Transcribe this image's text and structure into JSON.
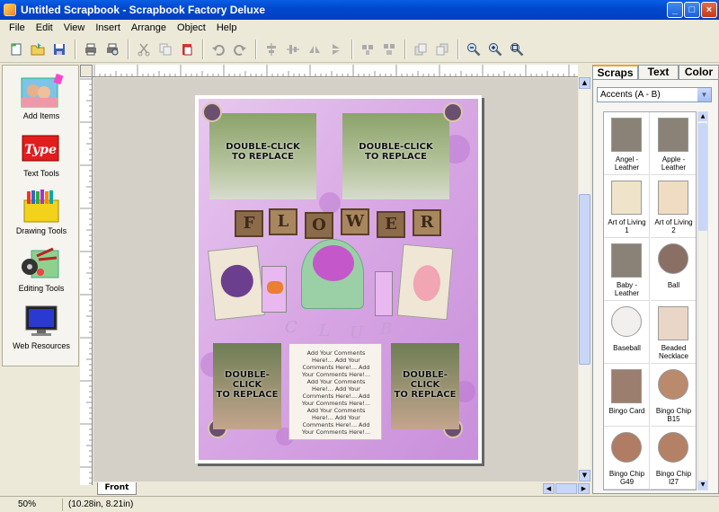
{
  "window": {
    "title": "Untitled Scrapbook - Scrapbook Factory Deluxe"
  },
  "menu": [
    "File",
    "Edit",
    "View",
    "Insert",
    "Arrange",
    "Object",
    "Help"
  ],
  "left_panel": {
    "items": [
      {
        "label": "Add Items"
      },
      {
        "label": "Text Tools"
      },
      {
        "label": "Drawing Tools"
      },
      {
        "label": "Editing Tools"
      },
      {
        "label": "Web Resources"
      }
    ]
  },
  "canvas": {
    "placeholder_text": "DOUBLE-CLICK\nTO REPLACE",
    "comment_text": "Add Your Comments\nHere!... Add Your\nComments Here!... Add\nYour Comments Here!...\nAdd Your Comments\nHere!... Add Your\nComments Here!... Add\nYour Comments Here!...\nAdd Your Comments\nHere!... Add Your\nComments Here!... Add\nYour Comments Here!...",
    "tiles_top": [
      "F",
      "L",
      "O",
      "W",
      "E",
      "R"
    ],
    "tiles_bottom": [
      "C",
      "L",
      "U",
      "B"
    ]
  },
  "bottom_tab": "Front",
  "status": {
    "zoom": "50%",
    "coords": "(10.28in, 8.21in)"
  },
  "right_panel": {
    "tabs": [
      "Scraps",
      "Text",
      "Color"
    ],
    "active_tab": "Scraps",
    "category": "Accents (A - B)",
    "items": [
      {
        "label": "Angel -\nLeather",
        "color": "#8a8276"
      },
      {
        "label": "Apple -\nLeather",
        "color": "#8a8276"
      },
      {
        "label": "Art of Living\n1",
        "color": "#efe3c9"
      },
      {
        "label": "Art of Living\n2",
        "color": "#efdcc3"
      },
      {
        "label": "Baby -\nLeather",
        "color": "#8a8276"
      },
      {
        "label": "Ball",
        "color": "#8a6f64"
      },
      {
        "label": "Baseball",
        "color": "#f2f0ee"
      },
      {
        "label": "Beaded\nNecklace",
        "color": "#e9d6c7"
      },
      {
        "label": "Bingo Card",
        "color": "#9c7e6e"
      },
      {
        "label": "Bingo Chip\nB15",
        "color": "#b98a6c"
      },
      {
        "label": "Bingo Chip\nG49",
        "color": "#b07c63"
      },
      {
        "label": "Bingo Chip\nI27",
        "color": "#b48066"
      }
    ]
  },
  "colors": {
    "accent_purple": "#c784d8",
    "title_blue": "#0a5ee4"
  }
}
